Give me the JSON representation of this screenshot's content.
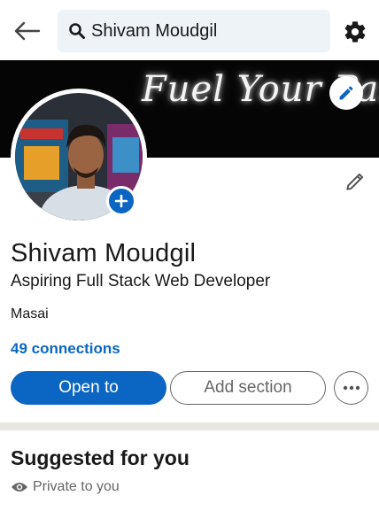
{
  "header": {
    "back_icon": "arrow-left-icon",
    "search": {
      "icon": "search-icon",
      "value": "Shivam Moudgil"
    },
    "settings_icon": "gear-icon"
  },
  "banner": {
    "text": "Fuel Your Passion",
    "edit_icon": "pencil-icon"
  },
  "profile": {
    "avatar_add_icon": "plus-icon",
    "edit_icon": "pencil-icon",
    "name": "Shivam Moudgil",
    "headline": "Aspiring Full Stack Web Developer",
    "company": "Masai",
    "connections": "49 connections"
  },
  "actions": {
    "open_to": "Open to",
    "add_section": "Add section",
    "more_icon": "more-horizontal-icon"
  },
  "suggested": {
    "title": "Suggested for you",
    "visibility_icon": "eye-icon",
    "visibility": "Private to you"
  },
  "colors": {
    "brand_blue": "#0a66c2",
    "search_bg": "#eef3f8",
    "secondary_text": "#666666",
    "divider": "#e8e6e1",
    "banner_bg": "#050505"
  }
}
